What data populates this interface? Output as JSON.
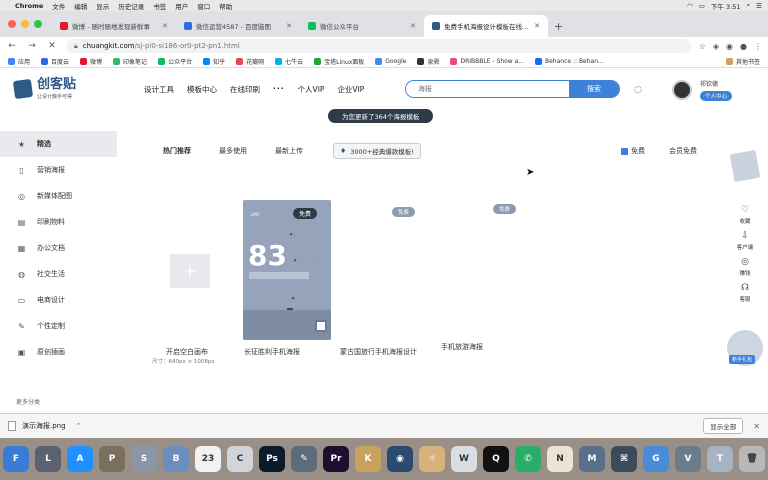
{
  "menubar": {
    "app": "Chrome",
    "items": [
      "文件",
      "编辑",
      "显示",
      "历史记录",
      "书签",
      "用户",
      "窗口",
      "帮助"
    ],
    "clock": "下午 3:51"
  },
  "tabs": [
    {
      "title": "微博 - 随时随地发现新鲜事",
      "color": "#e6162d"
    },
    {
      "title": "微信运营4587 - 百度脑图",
      "color": "#2d6be0"
    },
    {
      "title": "微信公众平台",
      "color": "#07c160"
    },
    {
      "title": "免费手机海报设计模板在线编辑",
      "color": "#2d5a88",
      "active": true
    }
  ],
  "address": {
    "host": "chuangkit.com",
    "path": "/sj-pi0-si186-or0-pt2-pn1.html"
  },
  "bookmarks": [
    {
      "label": "应用",
      "color": "#4285f4"
    },
    {
      "label": "百度云",
      "color": "#2d6be0"
    },
    {
      "label": "微博",
      "color": "#e6162d"
    },
    {
      "label": "印象笔记",
      "color": "#2dbe60"
    },
    {
      "label": "公众平台",
      "color": "#07c160"
    },
    {
      "label": "知乎",
      "color": "#0084ff"
    },
    {
      "label": "花瓣网",
      "color": "#e24b55"
    },
    {
      "label": "七牛云",
      "color": "#06aeef"
    },
    {
      "label": "宝塔Linux面板",
      "color": "#20a53a"
    },
    {
      "label": "Google",
      "color": "#4285f4"
    },
    {
      "label": "泉舜",
      "color": "#333333"
    },
    {
      "label": "DRIBBBLE - Show a...",
      "color": "#ea4c89"
    },
    {
      "label": "Behance :: Behan...",
      "color": "#1769ff"
    }
  ],
  "bookmarks_other": "其他书签",
  "site": {
    "logo_name": "创客贴",
    "logo_slogan": "让设计触手可得",
    "nav": [
      "设计工具",
      "模板中心",
      "在线印刷",
      "···",
      "个人VIP",
      "企业VIP"
    ],
    "search_placeholder": "海报",
    "search_button": "搜索",
    "username": "祁钦德",
    "user_center": "个人中心",
    "promo": "为您更新了364个海报模板"
  },
  "sidebar": {
    "items": [
      {
        "label": "精选",
        "icon": "★",
        "name": "star"
      },
      {
        "label": "营销海报",
        "icon": "▯",
        "name": "phone"
      },
      {
        "label": "新媒体配图",
        "icon": "◎",
        "name": "wechat"
      },
      {
        "label": "印刷物料",
        "icon": "▤",
        "name": "print"
      },
      {
        "label": "办公文档",
        "icon": "▦",
        "name": "document"
      },
      {
        "label": "社交生活",
        "icon": "◍",
        "name": "social"
      },
      {
        "label": "电商设计",
        "icon": "▭",
        "name": "shop"
      },
      {
        "label": "个性定制",
        "icon": "✎",
        "name": "pen"
      },
      {
        "label": "原创插画",
        "icon": "▣",
        "name": "image"
      }
    ],
    "footer": "更多分类"
  },
  "filters": {
    "tabs": [
      "热门推荐",
      "最多使用",
      "最新上传"
    ],
    "hot_badge": "3000+经典爆款模板!",
    "free": "免费",
    "member_free": "会员免费"
  },
  "templates": {
    "blank_label": "开启空白画布",
    "blank_size": "尺寸：640px × 1008px",
    "t1": "长征胜利手机海报",
    "t2": "蒙古国旅行手机海报设计",
    "t3": "手机旅游海报",
    "poster_tag": "免费",
    "poster_number": "83",
    "tag2": "免费",
    "tag3": "免费"
  },
  "rail": {
    "items": [
      "收藏",
      "客户端",
      "赚钱",
      "客服"
    ],
    "bottom": "新手礼包"
  },
  "download": {
    "file": "演示海报.png",
    "show_all": "显示全部"
  },
  "dock": [
    {
      "label": "F",
      "color": "#3a7bd5"
    },
    {
      "label": "L",
      "color": "#5a6270"
    },
    {
      "label": "A",
      "color": "#1e90ff"
    },
    {
      "label": "P",
      "color": "#7a6e5d"
    },
    {
      "label": "S",
      "color": "#8b95a5"
    },
    {
      "label": "B",
      "color": "#6c8ebf"
    },
    {
      "label": "23",
      "color": "#f2f2f2"
    },
    {
      "label": "C",
      "color": "#d1d4d9"
    },
    {
      "label": "Ps",
      "color": "#0b1b2b"
    },
    {
      "label": "✎",
      "color": "#5d6b7a"
    },
    {
      "label": "Pr",
      "color": "#1e0f2e"
    },
    {
      "label": "K",
      "color": "#c9a35d"
    },
    {
      "label": "◉",
      "color": "#2b4a6f"
    },
    {
      "label": "☼",
      "color": "#d7b27a"
    },
    {
      "label": "W",
      "color": "#d8dde3"
    },
    {
      "label": "Q",
      "color": "#111111"
    },
    {
      "label": "✆",
      "color": "#2aae67"
    },
    {
      "label": "N",
      "color": "#e9e4d6"
    },
    {
      "label": "M",
      "color": "#5a6f8c"
    },
    {
      "label": "⌘",
      "color": "#3c4a5c"
    },
    {
      "label": "G",
      "color": "#4a8bd8"
    },
    {
      "label": "V",
      "color": "#6a7b8c"
    },
    {
      "label": "T",
      "color": "#a7b3c2"
    },
    {
      "label": "🗑",
      "color": "#b8b8b8"
    }
  ]
}
